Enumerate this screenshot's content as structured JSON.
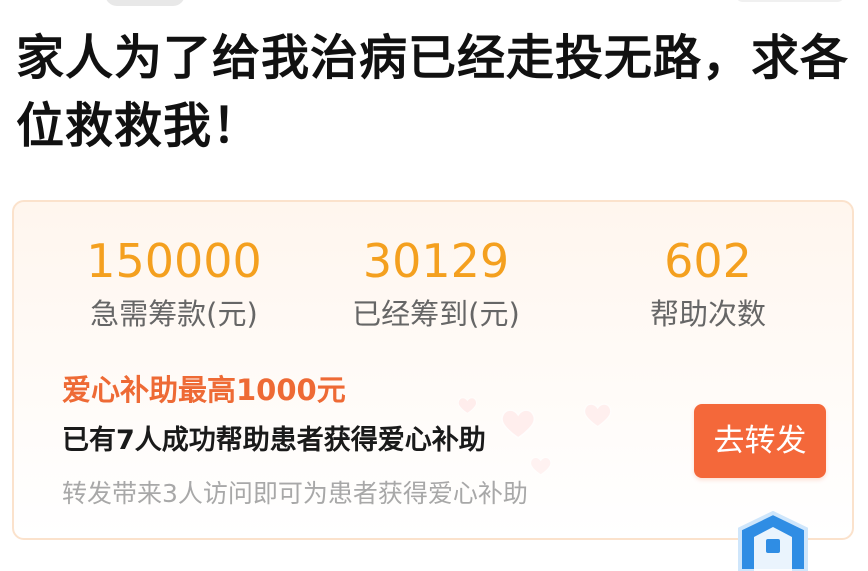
{
  "header": {
    "title": "家人为了给我治病已经走投无路，求各位救救我！"
  },
  "stats": [
    {
      "value": "150000",
      "label": "急需筹款(元)"
    },
    {
      "value": "30129",
      "label": "已经筹到(元)"
    },
    {
      "value": "602",
      "label": "帮助次数"
    }
  ],
  "subsidy": {
    "title": "爱心补助最高1000元",
    "count_text": "已有7人成功帮助患者获得爱心补助",
    "hint": "转发带来3人访问即可为患者获得爱心补助",
    "share_label": "去转发"
  },
  "colors": {
    "accent": "#f4a01f",
    "subsidy_title": "#ee6a35",
    "button": "#f4683a",
    "card_border": "#fbe2cc",
    "badge": "#2f8de4"
  },
  "icons": [
    "heart-icon",
    "shield-badge-icon"
  ]
}
